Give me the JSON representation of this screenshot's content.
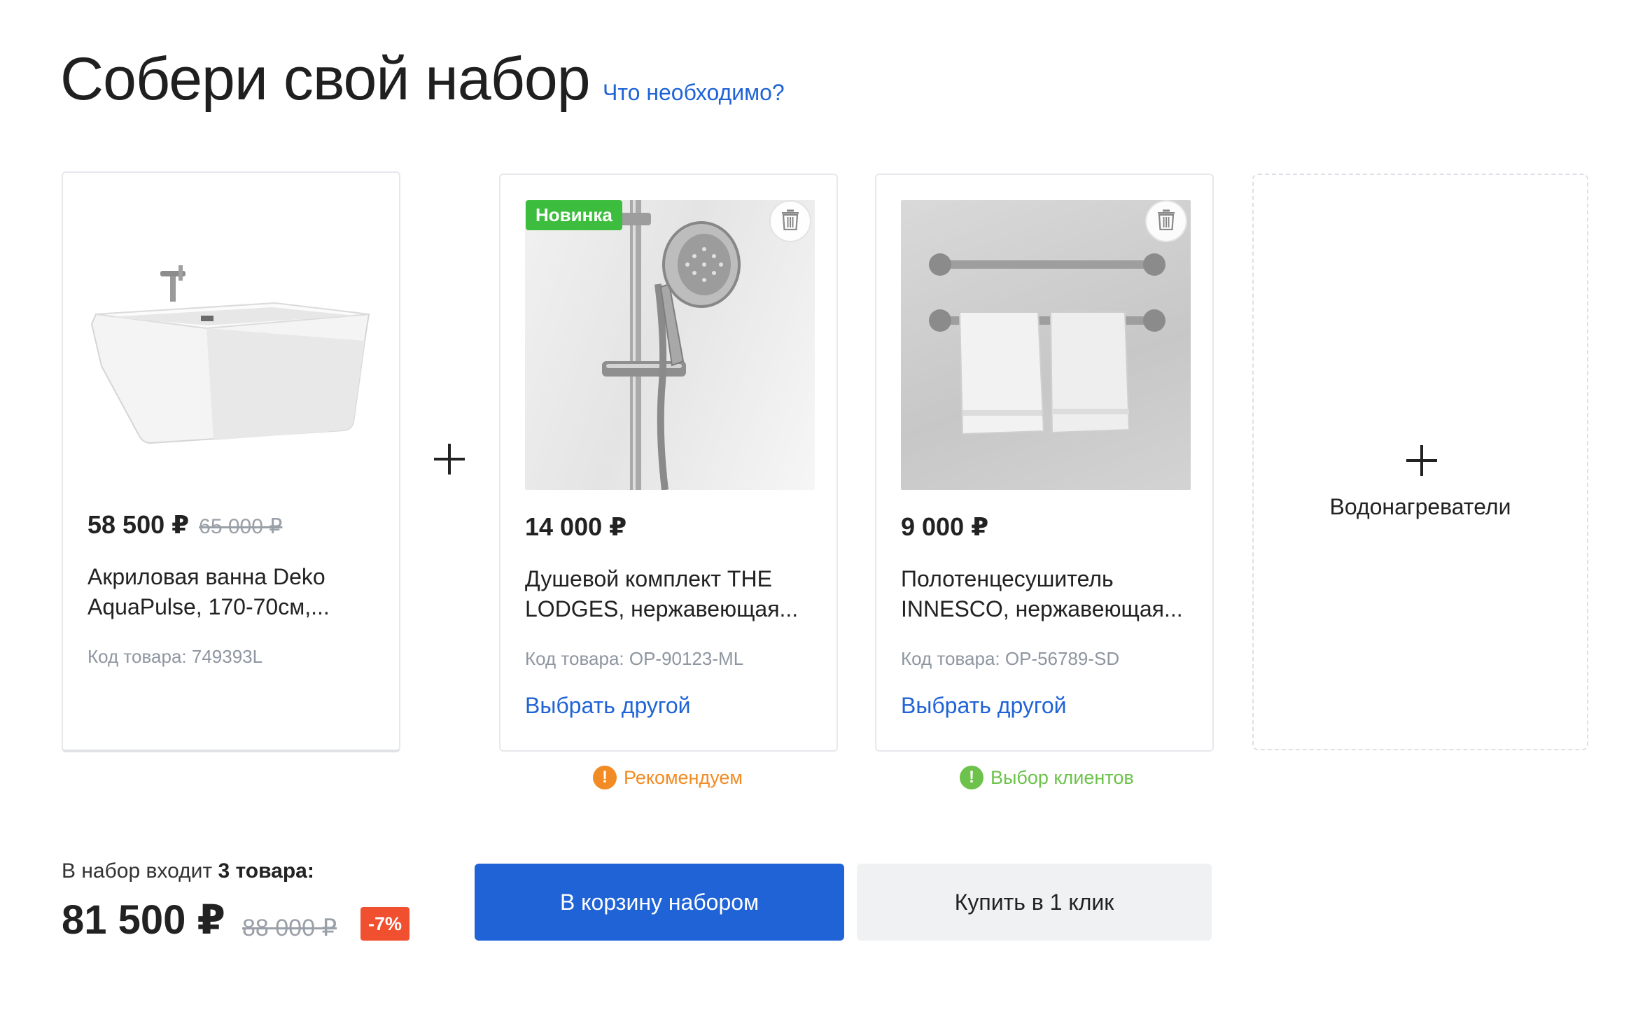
{
  "header": {
    "title": "Собери свой набор",
    "help_link": "Что необходимо?"
  },
  "products": [
    {
      "price": "58 500 ₽",
      "old_price": "65 000 ₽",
      "name_line1": "Акриловая ванна Deko",
      "name_line2": "AquaPulse, 170-70см,...",
      "code": "Код товара: 749393L",
      "image_icon": "bathtub-image"
    },
    {
      "badge": "Новинка",
      "price": "14 000 ₽",
      "name_line1": "Душевой комплект THE",
      "name_line2": "LODGES, нержавеющая...",
      "code": "Код товара: OP-90123-ML",
      "choose_other": "Выбрать другой",
      "tag": "Рекомендуем",
      "tag_color": "#f28b24",
      "image_icon": "shower-set-image"
    },
    {
      "price": "9 000 ₽",
      "name_line1": "Полотенцесушитель",
      "name_line2": "INNESCO, нержавеющая...",
      "code": "Код товара: OP-56789-SD",
      "choose_other": "Выбрать другой",
      "tag": "Выбор клиентов",
      "tag_color": "#6cc24a",
      "image_icon": "towel-rail-image"
    }
  ],
  "add_slot": {
    "label": "Водонагреватели"
  },
  "summary": {
    "count_prefix": "В набор входит ",
    "count_bold": "3 товара:",
    "total": "81 500 ₽",
    "old_total": "88 000 ₽",
    "discount": "-7%"
  },
  "actions": {
    "cart_label": "В корзину набором",
    "oneclick_label": "Купить в 1 клик"
  },
  "colors": {
    "accent": "#1f63d6",
    "new_badge": "#3dbd3d",
    "discount": "#f0502f"
  }
}
